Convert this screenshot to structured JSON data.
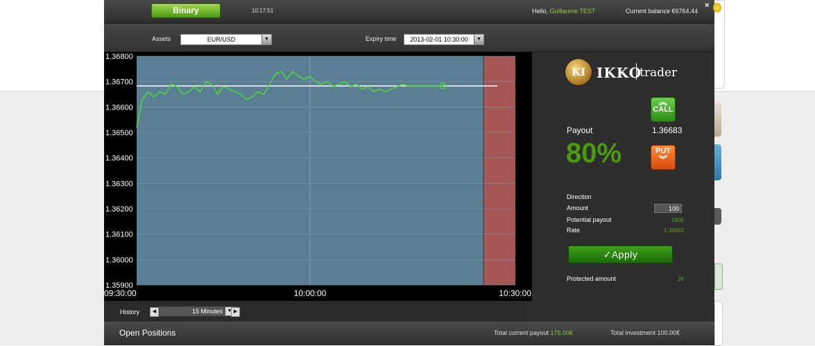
{
  "topbar": {
    "binary_tab": "Binary",
    "time": "10:17:51",
    "greeting_prefix": "Hello, ",
    "user_name": "Guillaume TEST",
    "balance": "Current balance €6764.44",
    "close_label": "×"
  },
  "filters": {
    "assets_label": "Assets",
    "asset_value": "EUR/USD",
    "expiry_label": "Expiry time",
    "expiry_value": "2013-02-01 10:30:00"
  },
  "chart_data": {
    "type": "line",
    "y_ticks": [
      "1.36800",
      "1.36700",
      "1.36600",
      "1.36500",
      "1.36400",
      "1.36300",
      "1.36200",
      "1.36100",
      "1.36000",
      "1.35900"
    ],
    "x_ticks": [
      "09:30:00",
      "10:00:00",
      "10:30:00"
    ],
    "ylim": [
      1.359,
      1.368
    ],
    "current_rate": 1.36683,
    "series_color": "#4fd63a",
    "series": [
      {
        "x_minutes": [
          0,
          1,
          2,
          3,
          4,
          5,
          6,
          7,
          8,
          9,
          10,
          11,
          12,
          13,
          14,
          15,
          16,
          17,
          18,
          19,
          20,
          21,
          22,
          23,
          24,
          25,
          26,
          27,
          28,
          29,
          30,
          31,
          32,
          33,
          34,
          35,
          36,
          37,
          38,
          39,
          40,
          41,
          42,
          43,
          44,
          45,
          46,
          47,
          48,
          49,
          50,
          51,
          52,
          53
        ],
        "values": [
          1.3652,
          1.3663,
          1.3666,
          1.3664,
          1.3666,
          1.3665,
          1.3669,
          1.3668,
          1.3665,
          1.3666,
          1.3668,
          1.3666,
          1.367,
          1.3669,
          1.3665,
          1.3668,
          1.3667,
          1.3666,
          1.3665,
          1.3663,
          1.3664,
          1.3666,
          1.3665,
          1.3669,
          1.3673,
          1.3674,
          1.3671,
          1.3674,
          1.3672,
          1.3671,
          1.3672,
          1.367,
          1.3669,
          1.367,
          1.3668,
          1.3669,
          1.367,
          1.3668,
          1.3669,
          1.3667,
          1.3668,
          1.3666,
          1.3667,
          1.3666,
          1.3667,
          1.3668,
          1.3669,
          1.36683,
          1.36683,
          1.36683,
          1.36683,
          1.36683,
          1.36683,
          1.36683
        ]
      }
    ]
  },
  "history": {
    "label": "History",
    "interval": "15 Minutes",
    "prev": "◀",
    "next": "▶",
    "dropdown": "▼"
  },
  "trade": {
    "logo_main": "IKKO",
    "logo_sub": "trader",
    "logo_coin": "KI",
    "call_label": "CALL",
    "put_label": "PUT",
    "payout_label": "Payout",
    "payout_pct": "80%",
    "current_rate": "1.36683",
    "direction_label": "Direction",
    "amount_label": "Amount",
    "amount_value": "100",
    "potential_label": "Potential payout",
    "potential_value": "180€",
    "rate_label": "Rate",
    "rate_value": "1.36683",
    "apply_label": "✓Apply",
    "protected_label": "Protected amount",
    "protected_value": "2€"
  },
  "positions": {
    "title": "Open Positions",
    "payout_label": "Total current payout ",
    "payout_value": "175.00€",
    "investment": "Total investment 100.00€"
  }
}
